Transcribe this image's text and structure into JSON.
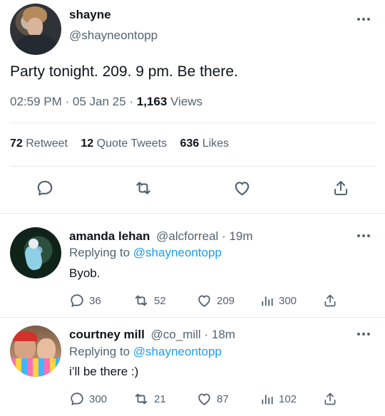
{
  "tweet": {
    "display_name": "shayne",
    "handle": "@shayneontopp",
    "text": "Party tonight. 209. 9 pm. Be there.",
    "time": "02:59 PM",
    "sep": "·",
    "date": "05 Jan 25",
    "views_count": "1,163",
    "views_label": "Views",
    "retweets_count": "72",
    "retweets_label": "Retweet",
    "quotes_count": "12",
    "quotes_label": "Quote Tweets",
    "likes_count": "636",
    "likes_label": "Likes"
  },
  "replies": [
    {
      "display_name": "amanda lehan",
      "handle": "@alcforreal",
      "sep": "·",
      "age": "19m",
      "replying_prefix": "Replying to",
      "replying_to": "@shayneontopp",
      "text": "Byob.",
      "reply_count": "36",
      "retweet_count": "52",
      "like_count": "209",
      "view_count": "300"
    },
    {
      "display_name": "courtney mill",
      "handle": "@co_mill",
      "sep": "·",
      "age": "18m",
      "replying_prefix": "Replying to",
      "replying_to": "@shayneontopp",
      "text": "i’ll be there :)",
      "reply_count": "300",
      "retweet_count": "21",
      "like_count": "87",
      "view_count": "102"
    }
  ],
  "colors": {
    "text": "#0f1419",
    "secondary": "#536471",
    "link": "#1d9bf0",
    "divider": "#e6e9ec"
  },
  "icons": [
    "more-icon",
    "reply-icon",
    "retweet-icon",
    "like-icon",
    "share-icon",
    "views-icon"
  ]
}
